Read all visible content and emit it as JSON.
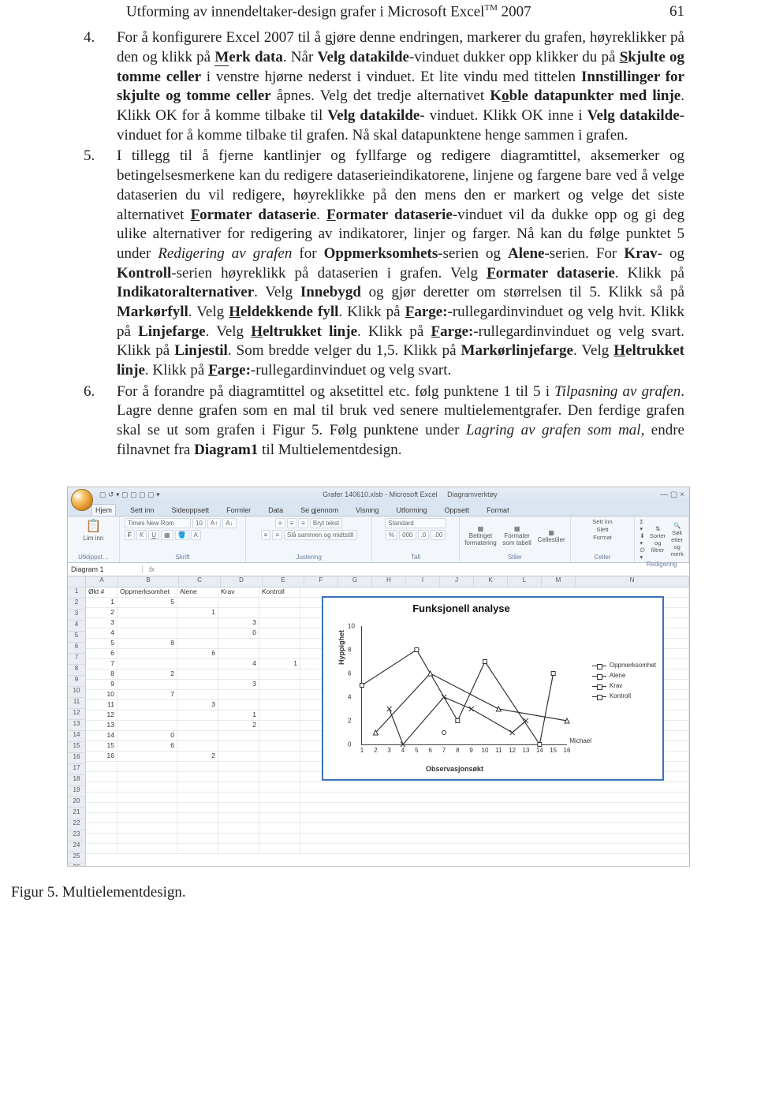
{
  "header": {
    "title": "Utforming av innendeltaker-design grafer i Microsoft Excel",
    "tm": "TM",
    "year": "2007",
    "page": "61"
  },
  "items": {
    "n4": "4.",
    "t4_a": "For å konfigurere Excel 2007 til å gjøre denne endringen, markerer du grafen, høyreklikker på den og klikk på ",
    "t4_merk": "Merk data",
    "t4_b": ". Når ",
    "t4_velg1": "Velg datakilde",
    "t4_c": "-vinduet dukker opp klikker du på ",
    "t4_skjulte": "Skjulte og tomme celler",
    "t4_d": " i venstre hjørne nederst i vinduet. Et lite vindu med tittelen ",
    "t4_inn": "Innstillinger for skjulte og tomme celler",
    "t4_e": " åpnes. Velg det tredje alternativet ",
    "t4_koble": "Koble datapunkter med linje",
    "t4_f": ". Klikk OK for å komme tilbake til ",
    "t4_velg2": "Velg datakilde",
    "t4_g": "- vinduet. Klikk OK inne i ",
    "t4_velg3": "Velg datakilde",
    "t4_h": "-vinduet for å komme tilbake til grafen. Nå skal datapunktene henge sammen i grafen.",
    "n5": "5.",
    "t5_a": "I tillegg til å fjerne kantlinjer og fyllfarge og redigere diagramtittel, aksemerker og betingelsesmerkene kan du redigere dataserieindikatorene, linjene og fargene bare ved å velge dataserien du vil redigere, høyreklikke på den mens den er markert og velge det siste alternativet ",
    "t5_fd1": "Formater dataserie",
    "t5_b": ". ",
    "t5_fd2": "Formater dataserie",
    "t5_c": "-vinduet vil da dukke opp og gi deg ulike alternativer for redigering av indikatorer, linjer og farger. Nå kan du følge punktet 5 under ",
    "t5_red": "Redigering av grafen",
    "t5_d": " for ",
    "t5_opp": "Oppmerksomhets",
    "t5_e": "-serien og ",
    "t5_alene": "Alene",
    "t5_f": "-serien. For ",
    "t5_krav": "Krav",
    "t5_g": "- og ",
    "t5_kontroll": "Kontroll",
    "t5_h": "-serien høyreklikk på dataserien i grafen. Velg ",
    "t5_fd3": "Formater dataserie",
    "t5_i": ". Klikk på ",
    "t5_ind": "Indikatoralternativer",
    "t5_j": ". Velg ",
    "t5_inne": "Innebygd",
    "t5_k": " og gjør deretter om størrelsen til 5. Klikk så på ",
    "t5_mf": "Markørfyll",
    "t5_l": ". Velg ",
    "t5_heldf": "Heldekkende fyll",
    "t5_m": ". Klikk på ",
    "t5_farge1": "Farge:",
    "t5_n": "-rullegardinvinduet og velg hvit. Klikk på ",
    "t5_lf": "Linjefarge",
    "t5_o": ". Velg ",
    "t5_heltr1": "Heltrukket linje",
    "t5_p": ". Klikk på ",
    "t5_farge2": "Farge:",
    "t5_q": "-rullegardinvinduet og velg svart. Klikk på ",
    "t5_ls": "Linjestil",
    "t5_r": ". Som bredde velger du 1,5. Klikk på ",
    "t5_mlf": "Markørlinjefarge",
    "t5_s": ". Velg ",
    "t5_heltr2": "Heltrukket linje",
    "t5_t": ". Klikk på ",
    "t5_farge3": "Farge:",
    "t5_u": "-rullegardinvinduet og velg svart.",
    "n6": "6.",
    "t6_a": "For å forandre på diagramtittel og aksetittel etc. følg punktene 1 til 5 i ",
    "t6_tilp": "Tilpasning av grafen",
    "t6_b": ". Lagre denne grafen som en mal til bruk ved senere multielementgrafer. Den ferdige grafen skal se ut som grafen i Figur 5. Følg punktene under ",
    "t6_lag": "Lagring av grafen som mal,",
    "t6_c": " endre filnavnet fra ",
    "t6_diag": "Diagram1",
    "t6_d": " til Multielementdesign."
  },
  "excel": {
    "title": "Grafer 140610.xlsb - Microsoft Excel",
    "tooltab": "Diagramverktøy",
    "tabs": [
      "Hjem",
      "Sett inn",
      "Sideoppsett",
      "Formler",
      "Data",
      "Se gjennom",
      "Visning",
      "Utforming",
      "Oppsett",
      "Format"
    ],
    "groups": {
      "utklipp": "Utklippst…",
      "skrift": "Skrift",
      "just": "Justering",
      "tall": "Tall",
      "stiler": "Stiler",
      "celler": "Celler",
      "red": "Redigering"
    },
    "font": "Times New Rom",
    "fontsize": "10",
    "r1": {
      "lim": "Lim inn",
      "bryt": "Bryt tekst",
      "sla": "Slå sammen og midtstill",
      "std": "Standard",
      "bet": "Betinget formatering",
      "form": "Formater som tabell",
      "cst": "Cellestiler",
      "sett": "Sett inn",
      "slett": "Slett",
      "fmt": "Format",
      "sort": "Sorter og filtrer",
      "sok": "Søk etter og merk"
    },
    "namebox": "Diagram 1",
    "fx": "fx",
    "cols": [
      "A",
      "B",
      "C",
      "D",
      "E",
      "F",
      "G",
      "H",
      "I",
      "J",
      "K",
      "L",
      "M",
      "N"
    ],
    "headers": {
      "okt": "Økt #",
      "opp": "Oppmerksomhet",
      "alene": "Alene",
      "krav": "Krav",
      "kontroll": "Kontroll"
    },
    "okt": [
      "1",
      "2",
      "3",
      "4",
      "5",
      "6",
      "7",
      "8",
      "9",
      "10",
      "11",
      "12",
      "13",
      "14",
      "15",
      "16"
    ],
    "opp": {
      "1": "5",
      "5": "8",
      "8": "2",
      "10": "7",
      "14": "0",
      "15": "6"
    },
    "alene": {
      "2": "1",
      "6": "6",
      "11": "3",
      "16": "2"
    },
    "krav": {
      "3": "3",
      "4": "0",
      "7": "4",
      "9": "3",
      "12": "1",
      "13": "2"
    },
    "kontroll": {
      "7": "1"
    }
  },
  "chart_data": {
    "type": "line",
    "title": "Funksjonell analyse",
    "xlabel": "Observasjonsøkt",
    "ylabel": "Hyppighet",
    "xlim": [
      1,
      16
    ],
    "ylim": [
      0,
      10
    ],
    "x": [
      1,
      2,
      3,
      4,
      5,
      6,
      7,
      8,
      9,
      10,
      11,
      12,
      13,
      14,
      15,
      16
    ],
    "series": [
      {
        "name": "Oppmerksomhet",
        "values": [
          5,
          null,
          null,
          null,
          8,
          null,
          null,
          2,
          null,
          7,
          null,
          null,
          null,
          0,
          6,
          null
        ]
      },
      {
        "name": "Alene",
        "values": [
          null,
          1,
          null,
          null,
          null,
          6,
          null,
          null,
          null,
          null,
          3,
          null,
          null,
          null,
          null,
          2
        ]
      },
      {
        "name": "Krav",
        "values": [
          null,
          null,
          3,
          0,
          null,
          null,
          4,
          null,
          3,
          null,
          null,
          1,
          2,
          null,
          null,
          null
        ]
      },
      {
        "name": "Kontroll",
        "values": [
          null,
          null,
          null,
          null,
          null,
          null,
          1,
          null,
          null,
          null,
          null,
          null,
          null,
          null,
          null,
          null
        ]
      }
    ],
    "annotation": "Michael"
  },
  "figcaption": "Figur 5. Multielementdesign."
}
